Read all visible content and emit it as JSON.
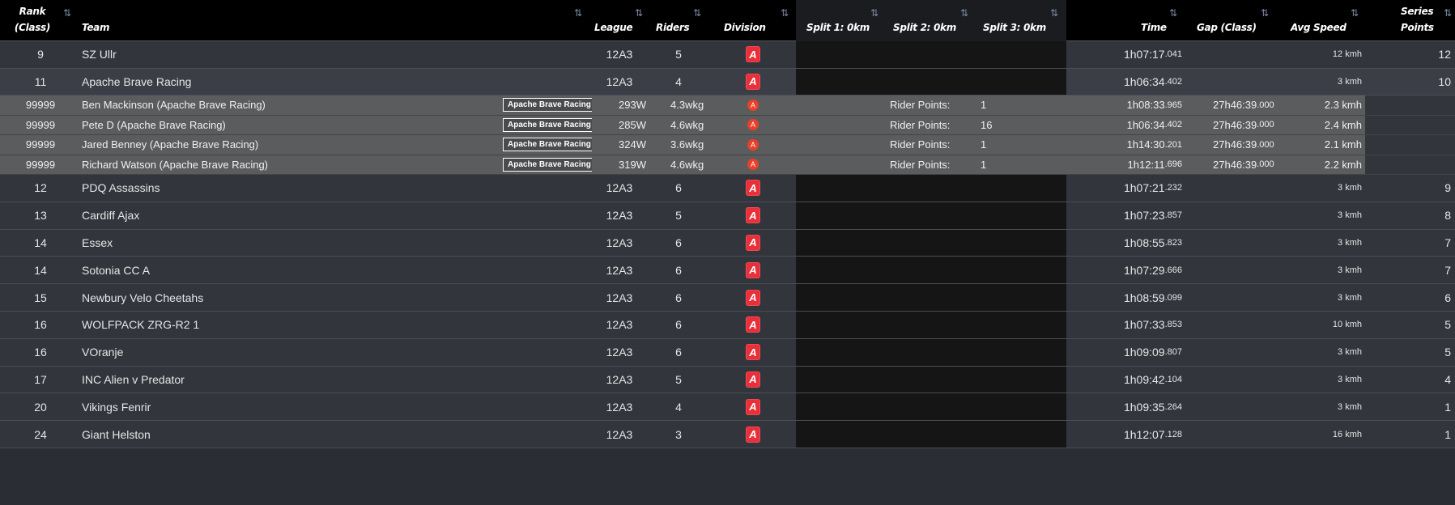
{
  "headers": {
    "rank_line1": "Rank",
    "rank_line2": "(Class)",
    "team": "Team",
    "league": "League",
    "riders": "Riders",
    "division": "Division",
    "split1": "Split 1: 0km",
    "split2": "Split 2: 0km",
    "split3": "Split 3: 0km",
    "time": "Time",
    "gap": "Gap (Class)",
    "avg_speed": "Avg Speed",
    "series_line1": "Series",
    "series_line2": "Points",
    "sort_icon": "⇅",
    "sort_down_icon": "↓"
  },
  "teams_top": [
    {
      "rank": "9",
      "team": "SZ Ullr",
      "league": "12A3",
      "riders": "5",
      "division": "A",
      "time_main": "1h07:17",
      "time_ms": ".041",
      "speed": "12 kmh",
      "points": "12"
    },
    {
      "rank": "11",
      "team": "Apache Brave Racing",
      "league": "12A3",
      "riders": "4",
      "division": "A",
      "time_main": "1h06:34",
      "time_ms": ".402",
      "speed": "3 kmh",
      "points": "10"
    }
  ],
  "riders": [
    {
      "rank": "99999",
      "name": "Ben Mackinson (Apache Brave Racing)",
      "tag": "Apache Brave Racing",
      "watts": "293W",
      "wkg": "4.3wkg",
      "division": "A",
      "points_label": "Rider Points:",
      "points": "1",
      "time_main": "1h08:33",
      "time_ms": ".965",
      "gap_main": "27h46:39",
      "gap_ms": ".000",
      "speed": "2.3 kmh"
    },
    {
      "rank": "99999",
      "name": "Pete D (Apache Brave Racing)",
      "tag": "Apache Brave Racing",
      "watts": "285W",
      "wkg": "4.6wkg",
      "division": "A",
      "points_label": "Rider Points:",
      "points": "16",
      "time_main": "1h06:34",
      "time_ms": ".402",
      "gap_main": "27h46:39",
      "gap_ms": ".000",
      "speed": "2.4 kmh"
    },
    {
      "rank": "99999",
      "name": "Jared Benney (Apache Brave Racing)",
      "tag": "Apache Brave Racing",
      "watts": "324W",
      "wkg": "3.6wkg",
      "division": "A",
      "points_label": "Rider Points:",
      "points": "1",
      "time_main": "1h14:30",
      "time_ms": ".201",
      "gap_main": "27h46:39",
      "gap_ms": ".000",
      "speed": "2.1 kmh"
    },
    {
      "rank": "99999",
      "name": "Richard Watson (Apache Brave Racing)",
      "tag": "Apache Brave Racing",
      "watts": "319W",
      "wkg": "4.6wkg",
      "division": "A",
      "points_label": "Rider Points:",
      "points": "1",
      "time_main": "1h12:11",
      "time_ms": ".696",
      "gap_main": "27h46:39",
      "gap_ms": ".000",
      "speed": "2.2 kmh"
    }
  ],
  "teams_bottom": [
    {
      "rank": "12",
      "team": "PDQ Assassins",
      "league": "12A3",
      "riders": "6",
      "division": "A",
      "time_main": "1h07:21",
      "time_ms": ".232",
      "speed": "3 kmh",
      "points": "9"
    },
    {
      "rank": "13",
      "team": "Cardiff Ajax",
      "league": "12A3",
      "riders": "5",
      "division": "A",
      "time_main": "1h07:23",
      "time_ms": ".857",
      "speed": "3 kmh",
      "points": "8"
    },
    {
      "rank": "14",
      "team": "Essex",
      "league": "12A3",
      "riders": "6",
      "division": "A",
      "time_main": "1h08:55",
      "time_ms": ".823",
      "speed": "3 kmh",
      "points": "7"
    },
    {
      "rank": "14",
      "team": "Sotonia CC A",
      "league": "12A3",
      "riders": "6",
      "division": "A",
      "time_main": "1h07:29",
      "time_ms": ".666",
      "speed": "3 kmh",
      "points": "7"
    },
    {
      "rank": "15",
      "team": "Newbury Velo Cheetahs",
      "league": "12A3",
      "riders": "6",
      "division": "A",
      "time_main": "1h08:59",
      "time_ms": ".099",
      "speed": "3 kmh",
      "points": "6"
    },
    {
      "rank": "16",
      "team": "WOLFPACK ZRG-R2 1",
      "league": "12A3",
      "riders": "6",
      "division": "A",
      "time_main": "1h07:33",
      "time_ms": ".853",
      "speed": "10 kmh",
      "points": "5"
    },
    {
      "rank": "16",
      "team": "VOranje",
      "league": "12A3",
      "riders": "6",
      "division": "A",
      "time_main": "1h09:09",
      "time_ms": ".807",
      "speed": "3 kmh",
      "points": "5"
    },
    {
      "rank": "17",
      "team": "INC Alien v Predator",
      "league": "12A3",
      "riders": "5",
      "division": "A",
      "time_main": "1h09:42",
      "time_ms": ".104",
      "speed": "3 kmh",
      "points": "4"
    },
    {
      "rank": "20",
      "team": "Vikings Fenrir",
      "league": "12A3",
      "riders": "4",
      "division": "A",
      "time_main": "1h09:35",
      "time_ms": ".264",
      "speed": "3 kmh",
      "points": "1"
    },
    {
      "rank": "24",
      "team": "Giant Helston",
      "league": "12A3",
      "riders": "3",
      "division": "A",
      "time_main": "1h12:07",
      "time_ms": ".128",
      "speed": "16 kmh",
      "points": "1"
    }
  ],
  "colors": {
    "division_badge": "#e8303a",
    "header_bg": "#000000",
    "split_bg": "#151516",
    "rider_row_bg": "#5b5c5e"
  }
}
